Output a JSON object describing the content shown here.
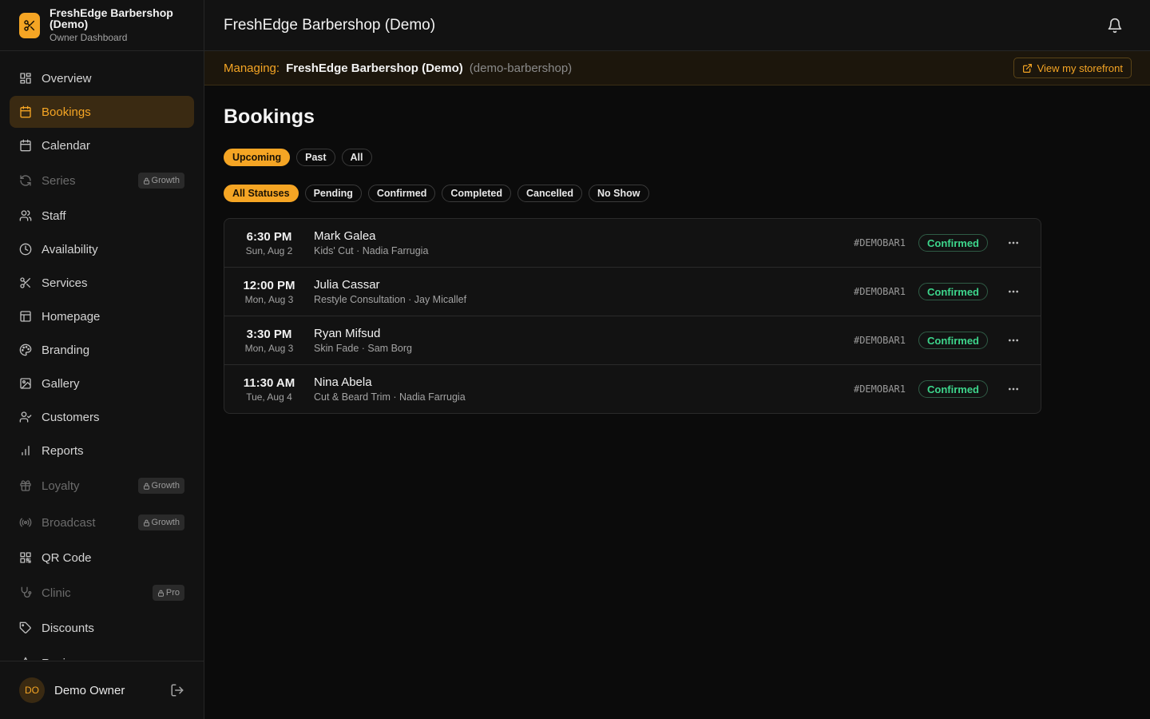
{
  "brand": {
    "name": "FreshEdge Barbershop (Demo)",
    "subtitle": "Owner Dashboard"
  },
  "nav": [
    {
      "label": "Overview",
      "icon": "grid-icon",
      "active": false,
      "locked": false,
      "badge": ""
    },
    {
      "label": "Bookings",
      "icon": "calendar-icon",
      "active": true,
      "locked": false,
      "badge": ""
    },
    {
      "label": "Calendar",
      "icon": "calendar-icon",
      "active": false,
      "locked": false,
      "badge": ""
    },
    {
      "label": "Series",
      "icon": "repeat-icon",
      "active": false,
      "locked": true,
      "badge": "Growth"
    },
    {
      "label": "Staff",
      "icon": "users-icon",
      "active": false,
      "locked": false,
      "badge": ""
    },
    {
      "label": "Availability",
      "icon": "clock-icon",
      "active": false,
      "locked": false,
      "badge": ""
    },
    {
      "label": "Services",
      "icon": "scissors-icon",
      "active": false,
      "locked": false,
      "badge": ""
    },
    {
      "label": "Homepage",
      "icon": "layout-icon",
      "active": false,
      "locked": false,
      "badge": ""
    },
    {
      "label": "Branding",
      "icon": "palette-icon",
      "active": false,
      "locked": false,
      "badge": ""
    },
    {
      "label": "Gallery",
      "icon": "image-icon",
      "active": false,
      "locked": false,
      "badge": ""
    },
    {
      "label": "Customers",
      "icon": "user-check-icon",
      "active": false,
      "locked": false,
      "badge": ""
    },
    {
      "label": "Reports",
      "icon": "bar-chart-icon",
      "active": false,
      "locked": false,
      "badge": ""
    },
    {
      "label": "Loyalty",
      "icon": "gift-icon",
      "active": false,
      "locked": true,
      "badge": "Growth"
    },
    {
      "label": "Broadcast",
      "icon": "broadcast-icon",
      "active": false,
      "locked": true,
      "badge": "Growth"
    },
    {
      "label": "QR Code",
      "icon": "qr-icon",
      "active": false,
      "locked": false,
      "badge": ""
    },
    {
      "label": "Clinic",
      "icon": "stethoscope-icon",
      "active": false,
      "locked": true,
      "badge": "Pro"
    },
    {
      "label": "Discounts",
      "icon": "tag-icon",
      "active": false,
      "locked": false,
      "badge": ""
    },
    {
      "label": "Reviews",
      "icon": "star-icon",
      "active": false,
      "locked": false,
      "badge": ""
    }
  ],
  "user": {
    "initials": "DO",
    "name": "Demo Owner"
  },
  "topbar": {
    "title": "FreshEdge Barbershop (Demo)"
  },
  "managing": {
    "label": "Managing:",
    "name": "FreshEdge Barbershop (Demo)",
    "slug": "(demo-barbershop)",
    "storefront_label": "View my storefront"
  },
  "page": {
    "title": "Bookings"
  },
  "time_filters": [
    {
      "label": "Upcoming",
      "active": true
    },
    {
      "label": "Past",
      "active": false
    },
    {
      "label": "All",
      "active": false
    }
  ],
  "status_filters": [
    {
      "label": "All Statuses",
      "active": true
    },
    {
      "label": "Pending",
      "active": false
    },
    {
      "label": "Confirmed",
      "active": false
    },
    {
      "label": "Completed",
      "active": false
    },
    {
      "label": "Cancelled",
      "active": false
    },
    {
      "label": "No Show",
      "active": false
    }
  ],
  "bookings": [
    {
      "time": "6:30 PM",
      "date": "Sun, Aug 2",
      "customer": "Mark Galea",
      "details": "Kids' Cut · Nadia Farrugia",
      "ref": "#DEMOBAR1",
      "status": "Confirmed"
    },
    {
      "time": "12:00 PM",
      "date": "Mon, Aug 3",
      "customer": "Julia Cassar",
      "details": "Restyle Consultation · Jay Micallef",
      "ref": "#DEMOBAR1",
      "status": "Confirmed"
    },
    {
      "time": "3:30 PM",
      "date": "Mon, Aug 3",
      "customer": "Ryan Mifsud",
      "details": "Skin Fade · Sam Borg",
      "ref": "#DEMOBAR1",
      "status": "Confirmed"
    },
    {
      "time": "11:30 AM",
      "date": "Tue, Aug 4",
      "customer": "Nina Abela",
      "details": "Cut & Beard Trim · Nadia Farrugia",
      "ref": "#DEMOBAR1",
      "status": "Confirmed"
    }
  ],
  "colors": {
    "accent": "#f5a524",
    "success": "#3dd68c"
  }
}
